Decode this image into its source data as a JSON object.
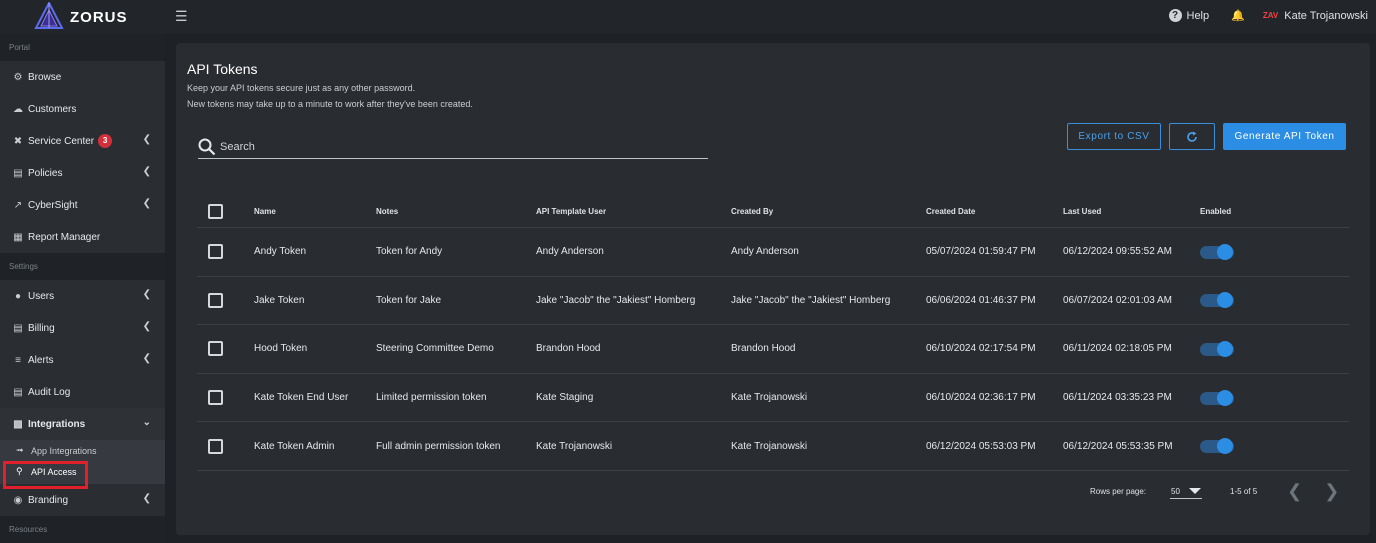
{
  "topbar": {
    "logo_text": "ZORUS",
    "help_label": "Help",
    "avatar_initials": "ZAV",
    "user_name": "Kate Trojanowski"
  },
  "sidebar": {
    "sections": {
      "portal": "Portal",
      "settings": "Settings",
      "resources": "Resources"
    },
    "items": [
      {
        "label": "Browse",
        "icon": "browse-icon"
      },
      {
        "label": "Customers",
        "icon": "cloud-icon"
      },
      {
        "label": "Service Center",
        "icon": "tools-icon",
        "badge": "3"
      },
      {
        "label": "Policies",
        "icon": "folder-icon"
      },
      {
        "label": "CyberSight",
        "icon": "chart-icon"
      },
      {
        "label": "Report Manager",
        "icon": "report-icon"
      },
      {
        "label": "Users",
        "icon": "users-icon"
      },
      {
        "label": "Billing",
        "icon": "billing-icon"
      },
      {
        "label": "Alerts",
        "icon": "alerts-icon"
      },
      {
        "label": "Audit Log",
        "icon": "audit-icon"
      },
      {
        "label": "Integrations",
        "icon": "integrations-icon"
      },
      {
        "label": "Branding",
        "icon": "branding-icon"
      }
    ],
    "integrations_sub": [
      {
        "label": "App Integrations",
        "icon": "app-integrations-icon"
      },
      {
        "label": "API Access",
        "icon": "key-icon"
      }
    ]
  },
  "main": {
    "title": "API Tokens",
    "subtitle_1": "Keep your API tokens secure just as any other password.",
    "subtitle_2": "New tokens may take up to a minute to work after they've been created.",
    "search_placeholder": "Search",
    "export_label": "Export to CSV",
    "generate_label": "Generate API Token",
    "accent_color": "#2b8de3"
  },
  "table": {
    "columns": [
      "Name",
      "Notes",
      "API Template User",
      "Created By",
      "Created Date",
      "Last Used",
      "Enabled"
    ],
    "rows": [
      {
        "name": "Andy Token",
        "notes": "Token for Andy",
        "template_user": "Andy Anderson",
        "created_by": "Andy Anderson",
        "created_date": "05/07/2024 01:59:47 PM",
        "last_used": "06/12/2024 09:55:52 AM",
        "enabled": true
      },
      {
        "name": "Jake Token",
        "notes": "Token for Jake",
        "template_user": "Jake \"Jacob\" the \"Jakiest\" Homberg",
        "created_by": "Jake \"Jacob\" the \"Jakiest\" Homberg",
        "created_date": "06/06/2024 01:46:37 PM",
        "last_used": "06/07/2024 02:01:03 AM",
        "enabled": true
      },
      {
        "name": "Hood Token",
        "notes": "Steering Committee Demo",
        "template_user": "Brandon Hood",
        "created_by": "Brandon Hood",
        "created_date": "06/10/2024 02:17:54 PM",
        "last_used": "06/11/2024 02:18:05 PM",
        "enabled": true
      },
      {
        "name": "Kate Token End User",
        "notes": "Limited permission token",
        "template_user": "Kate Staging",
        "created_by": "Kate Trojanowski",
        "created_date": "06/10/2024 02:36:17 PM",
        "last_used": "06/11/2024 03:35:23 PM",
        "enabled": true
      },
      {
        "name": "Kate Token Admin",
        "notes": "Full admin permission token",
        "template_user": "Kate Trojanowski",
        "created_by": "Kate Trojanowski",
        "created_date": "06/12/2024 05:53:03 PM",
        "last_used": "06/12/2024 05:53:35 PM",
        "enabled": true
      }
    ]
  },
  "pagination": {
    "rows_per_page_label": "Rows per page:",
    "rows_per_page": "50",
    "range": "1-5 of 5"
  }
}
